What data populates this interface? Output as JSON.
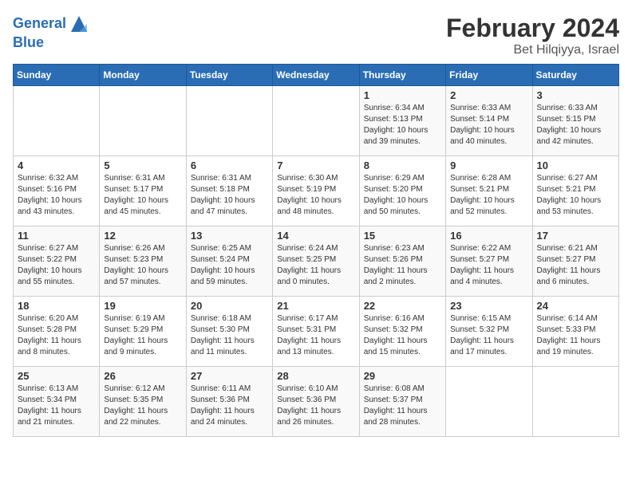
{
  "header": {
    "logo_line1": "General",
    "logo_line2": "Blue",
    "month_title": "February 2024",
    "location": "Bet Hilqiyya, Israel"
  },
  "weekdays": [
    "Sunday",
    "Monday",
    "Tuesday",
    "Wednesday",
    "Thursday",
    "Friday",
    "Saturday"
  ],
  "weeks": [
    [
      {
        "day": "",
        "info": ""
      },
      {
        "day": "",
        "info": ""
      },
      {
        "day": "",
        "info": ""
      },
      {
        "day": "",
        "info": ""
      },
      {
        "day": "1",
        "info": "Sunrise: 6:34 AM\nSunset: 5:13 PM\nDaylight: 10 hours\nand 39 minutes."
      },
      {
        "day": "2",
        "info": "Sunrise: 6:33 AM\nSunset: 5:14 PM\nDaylight: 10 hours\nand 40 minutes."
      },
      {
        "day": "3",
        "info": "Sunrise: 6:33 AM\nSunset: 5:15 PM\nDaylight: 10 hours\nand 42 minutes."
      }
    ],
    [
      {
        "day": "4",
        "info": "Sunrise: 6:32 AM\nSunset: 5:16 PM\nDaylight: 10 hours\nand 43 minutes."
      },
      {
        "day": "5",
        "info": "Sunrise: 6:31 AM\nSunset: 5:17 PM\nDaylight: 10 hours\nand 45 minutes."
      },
      {
        "day": "6",
        "info": "Sunrise: 6:31 AM\nSunset: 5:18 PM\nDaylight: 10 hours\nand 47 minutes."
      },
      {
        "day": "7",
        "info": "Sunrise: 6:30 AM\nSunset: 5:19 PM\nDaylight: 10 hours\nand 48 minutes."
      },
      {
        "day": "8",
        "info": "Sunrise: 6:29 AM\nSunset: 5:20 PM\nDaylight: 10 hours\nand 50 minutes."
      },
      {
        "day": "9",
        "info": "Sunrise: 6:28 AM\nSunset: 5:21 PM\nDaylight: 10 hours\nand 52 minutes."
      },
      {
        "day": "10",
        "info": "Sunrise: 6:27 AM\nSunset: 5:21 PM\nDaylight: 10 hours\nand 53 minutes."
      }
    ],
    [
      {
        "day": "11",
        "info": "Sunrise: 6:27 AM\nSunset: 5:22 PM\nDaylight: 10 hours\nand 55 minutes."
      },
      {
        "day": "12",
        "info": "Sunrise: 6:26 AM\nSunset: 5:23 PM\nDaylight: 10 hours\nand 57 minutes."
      },
      {
        "day": "13",
        "info": "Sunrise: 6:25 AM\nSunset: 5:24 PM\nDaylight: 10 hours\nand 59 minutes."
      },
      {
        "day": "14",
        "info": "Sunrise: 6:24 AM\nSunset: 5:25 PM\nDaylight: 11 hours\nand 0 minutes."
      },
      {
        "day": "15",
        "info": "Sunrise: 6:23 AM\nSunset: 5:26 PM\nDaylight: 11 hours\nand 2 minutes."
      },
      {
        "day": "16",
        "info": "Sunrise: 6:22 AM\nSunset: 5:27 PM\nDaylight: 11 hours\nand 4 minutes."
      },
      {
        "day": "17",
        "info": "Sunrise: 6:21 AM\nSunset: 5:27 PM\nDaylight: 11 hours\nand 6 minutes."
      }
    ],
    [
      {
        "day": "18",
        "info": "Sunrise: 6:20 AM\nSunset: 5:28 PM\nDaylight: 11 hours\nand 8 minutes."
      },
      {
        "day": "19",
        "info": "Sunrise: 6:19 AM\nSunset: 5:29 PM\nDaylight: 11 hours\nand 9 minutes."
      },
      {
        "day": "20",
        "info": "Sunrise: 6:18 AM\nSunset: 5:30 PM\nDaylight: 11 hours\nand 11 minutes."
      },
      {
        "day": "21",
        "info": "Sunrise: 6:17 AM\nSunset: 5:31 PM\nDaylight: 11 hours\nand 13 minutes."
      },
      {
        "day": "22",
        "info": "Sunrise: 6:16 AM\nSunset: 5:32 PM\nDaylight: 11 hours\nand 15 minutes."
      },
      {
        "day": "23",
        "info": "Sunrise: 6:15 AM\nSunset: 5:32 PM\nDaylight: 11 hours\nand 17 minutes."
      },
      {
        "day": "24",
        "info": "Sunrise: 6:14 AM\nSunset: 5:33 PM\nDaylight: 11 hours\nand 19 minutes."
      }
    ],
    [
      {
        "day": "25",
        "info": "Sunrise: 6:13 AM\nSunset: 5:34 PM\nDaylight: 11 hours\nand 21 minutes."
      },
      {
        "day": "26",
        "info": "Sunrise: 6:12 AM\nSunset: 5:35 PM\nDaylight: 11 hours\nand 22 minutes."
      },
      {
        "day": "27",
        "info": "Sunrise: 6:11 AM\nSunset: 5:36 PM\nDaylight: 11 hours\nand 24 minutes."
      },
      {
        "day": "28",
        "info": "Sunrise: 6:10 AM\nSunset: 5:36 PM\nDaylight: 11 hours\nand 26 minutes."
      },
      {
        "day": "29",
        "info": "Sunrise: 6:08 AM\nSunset: 5:37 PM\nDaylight: 11 hours\nand 28 minutes."
      },
      {
        "day": "",
        "info": ""
      },
      {
        "day": "",
        "info": ""
      }
    ]
  ]
}
